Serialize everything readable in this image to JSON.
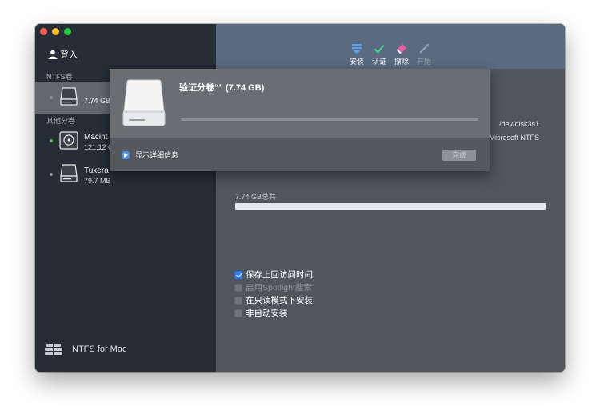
{
  "sidebar": {
    "login_label": "登入",
    "sections": {
      "ntfs": "NTFS卷",
      "other": "其他分卷"
    },
    "volumes": [
      {
        "name": "",
        "size": "7.74 GB",
        "selected": true,
        "status": "gray"
      },
      {
        "name": "Macint",
        "size": "121.12 G",
        "selected": false,
        "status": "green"
      },
      {
        "name": "Tuxera",
        "size": "79.7 MB",
        "selected": false,
        "status": "gray"
      }
    ],
    "brand": "NTFS for Mac"
  },
  "toolbar": {
    "items": [
      {
        "label": "安装",
        "icon": "mount-icon",
        "enabled": true
      },
      {
        "label": "认证",
        "icon": "check-icon",
        "enabled": true
      },
      {
        "label": "擦除",
        "icon": "eraser-icon",
        "enabled": true
      },
      {
        "label": "开始",
        "icon": "start-icon",
        "enabled": false
      }
    ]
  },
  "details": {
    "device": "/dev/disk3s1",
    "filesystem": "Microsoft NTFS",
    "capacity_label": "7.74 GB总共"
  },
  "options": [
    {
      "label": "保存上回访问时间",
      "checked": true,
      "enabled": true
    },
    {
      "label": "启用Spotlight搜索",
      "checked": false,
      "enabled": false
    },
    {
      "label": "在只读模式下安装",
      "checked": false,
      "enabled": true
    },
    {
      "label": "非自动安装",
      "checked": false,
      "enabled": true
    }
  ],
  "sheet": {
    "title": "验证分卷“” (7.74 GB)",
    "progress": 0,
    "show_details": "显示详细信息",
    "done_label": "完成",
    "done_enabled": false
  },
  "colors": {
    "sidebar_bg": "#262d36",
    "main_bg": "#4f565d",
    "toolbar_bg": "#5a6a80",
    "accent": "#2e7cf6",
    "status_green": "#3fbf4a"
  }
}
